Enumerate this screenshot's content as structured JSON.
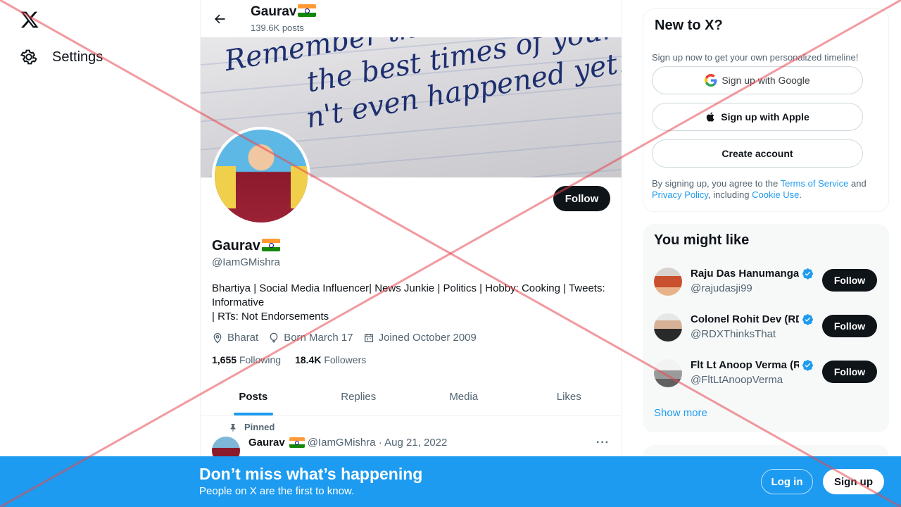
{
  "nav": {
    "settings_label": "Settings"
  },
  "header": {
    "title": "Gaurav",
    "posts_count": "139.6K posts"
  },
  "banner": {
    "lines": [
      "Remember that some of",
      "the best times of your life",
      "n't even happened yet."
    ]
  },
  "profile": {
    "follow_label": "Follow",
    "name": "Gaurav",
    "handle": "@IamGMishra",
    "bio_line1": "Bhartiya | Social Media Influencer| News Junkie | Politics | Hobby: Cooking | Tweets: Informative",
    "bio_line2": "| RTs: Not Endorsements",
    "location": "Bharat",
    "born": "Born March 17",
    "joined": "Joined October 2009",
    "following_count": "1,655",
    "following_label": "Following",
    "followers_count": "18.4K",
    "followers_label": "Followers"
  },
  "tabs": [
    {
      "label": "Posts",
      "active": true
    },
    {
      "label": "Replies",
      "active": false
    },
    {
      "label": "Media",
      "active": false
    },
    {
      "label": "Likes",
      "active": false
    }
  ],
  "pinned_post": {
    "pinned_label": "Pinned",
    "author": "Gaurav",
    "handle_date": "@IamGMishra · Aug 21, 2022",
    "more": "···"
  },
  "signup_card": {
    "title": "New to X?",
    "subtitle": "Sign up now to get your own personalized timeline!",
    "google_label": "Sign up with Google",
    "apple_label": "Sign up with Apple",
    "create_label": "Create account",
    "terms_prefix": "By signing up, you agree to the ",
    "terms_link": "Terms of Service",
    "terms_and": " and ",
    "privacy_link": "Privacy Policy",
    "terms_including": ", including ",
    "cookie_link": "Cookie Use",
    "terms_end": "."
  },
  "suggestions": {
    "title": "You might like",
    "items": [
      {
        "name": "Raju Das Hanumanga",
        "handle": "@rajudasji99",
        "follow": "Follow"
      },
      {
        "name": "Colonel Rohit Dev (RD",
        "handle": "@RDXThinksThat",
        "follow": "Follow"
      },
      {
        "name": "Flt Lt Anoop Verma (R",
        "handle": "@FltLtAnoopVerma",
        "follow": "Follow"
      }
    ],
    "show_more": "Show more"
  },
  "bottom_bar": {
    "title": "Don’t miss what’s happening",
    "subtitle": "People on X are the first to know.",
    "login_label": "Log in",
    "signup_label": "Sign up"
  },
  "colors": {
    "accent": "#1d9bf0",
    "text": "#0f1419",
    "muted": "#536471",
    "overlay_x": "#e8474f"
  }
}
